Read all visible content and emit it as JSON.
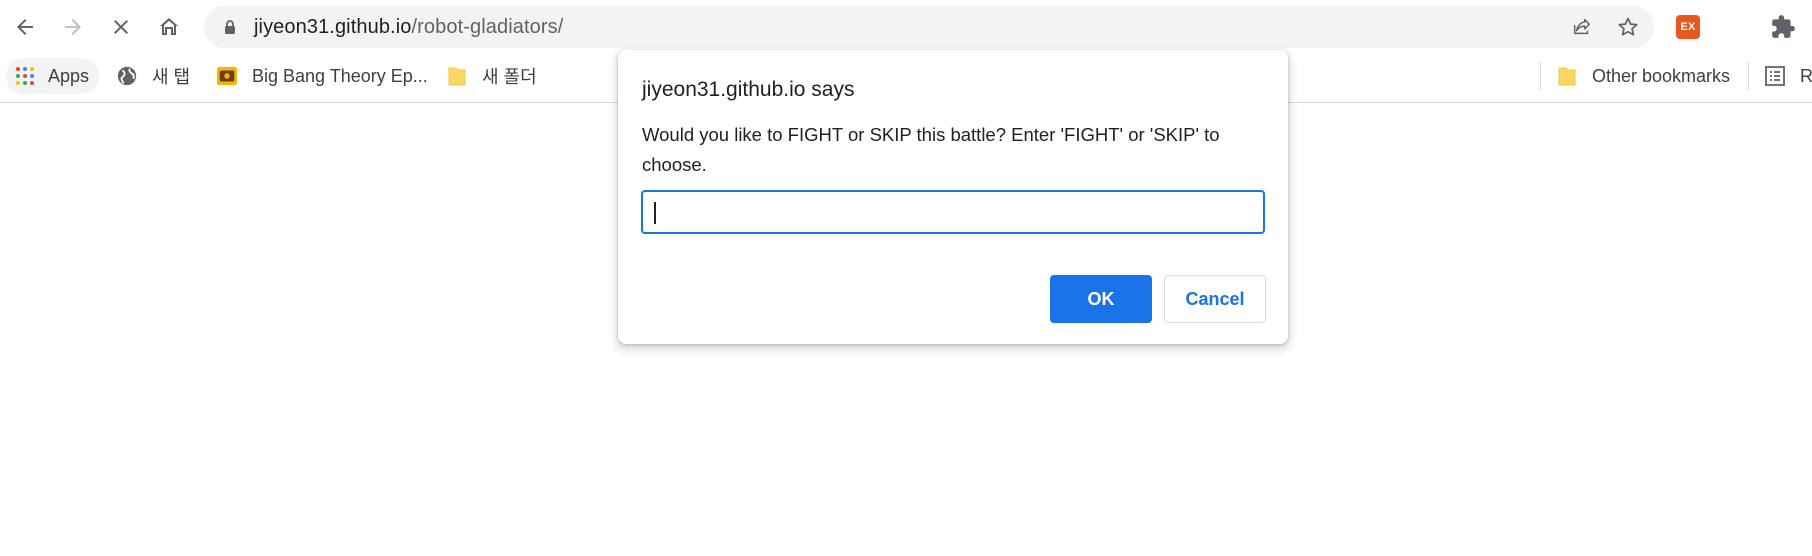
{
  "toolbar": {
    "back_icon": "arrow-left-icon",
    "forward_icon": "arrow-right-icon",
    "stop_icon": "close-icon",
    "home_icon": "home-icon",
    "url_host": "jiyeon31.github.io",
    "url_path": "/robot-gladiators/",
    "share_icon": "share-icon",
    "star_icon": "star-icon",
    "extension_badge": "EX",
    "extension_color": "#e8571e",
    "extensions_icon": "puzzle-icon"
  },
  "bookmarks": {
    "items": [
      {
        "label": "Apps",
        "icon": "apps-grid-icon"
      },
      {
        "label": "새 탭",
        "icon": "globe-icon"
      },
      {
        "label": "Big Bang Theory Ep...",
        "icon": "tv-icon"
      },
      {
        "label": "새 폴더",
        "icon": "folder-icon"
      }
    ],
    "other": {
      "label": "Other bookmarks",
      "icon": "folder-icon"
    },
    "reading": {
      "label": "Re",
      "icon": "reading-list-icon"
    }
  },
  "dialog": {
    "title": "jiyeon31.github.io says",
    "message": "Would you like to FIGHT or SKIP this battle? Enter 'FIGHT' or 'SKIP' to choose.",
    "input_value": "",
    "ok_label": "OK",
    "cancel_label": "Cancel",
    "accent_color": "#1a73e8"
  }
}
